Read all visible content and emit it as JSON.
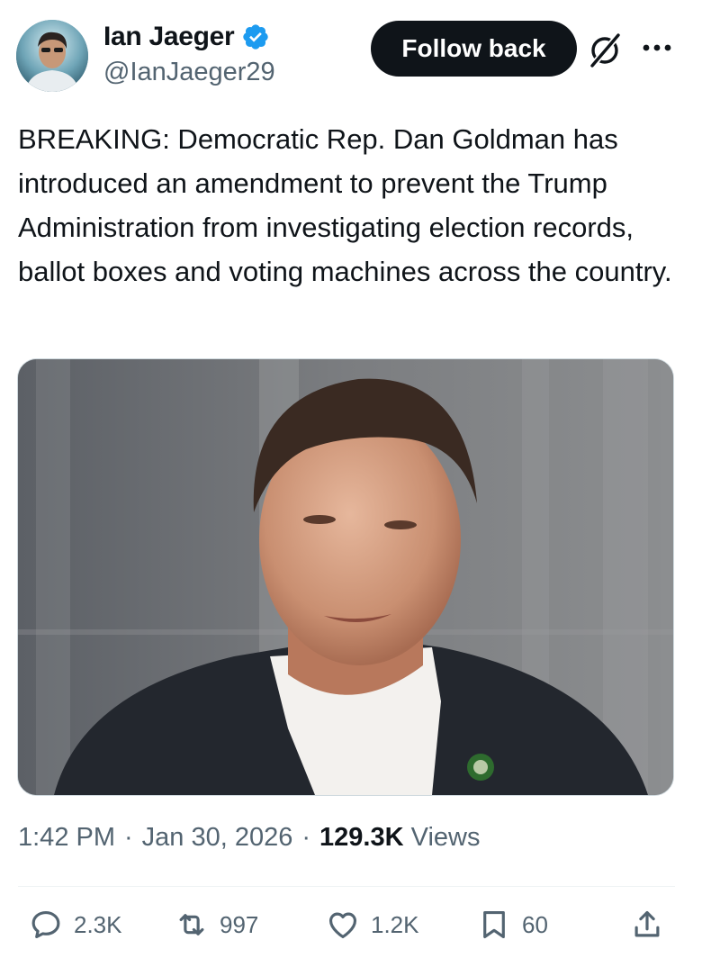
{
  "author": {
    "name": "Ian Jaeger",
    "handle": "@IanJaeger29",
    "verified": true,
    "verified_color": "#1d9bf0"
  },
  "header": {
    "follow_label": "Follow back",
    "grok_icon": "grok-icon",
    "more_icon": "more-dots-icon"
  },
  "tweet": {
    "text": "BREAKING: Democratic Rep. Dan Goldman has introduced an amendment to prevent the Trump Administration from investigating election records, ballot boxes and voting machines across the country."
  },
  "meta": {
    "time": "1:42 PM",
    "sep1": "·",
    "date": "Jan 30, 2026",
    "sep2": "·",
    "views_count": "129.3K",
    "views_label": "Views"
  },
  "actions": {
    "replies": "2.3K",
    "reposts": "997",
    "likes": "1.2K",
    "bookmarks": "60"
  },
  "colors": {
    "text": "#0f1419",
    "muted": "#536471",
    "button_bg": "#0f1419"
  }
}
